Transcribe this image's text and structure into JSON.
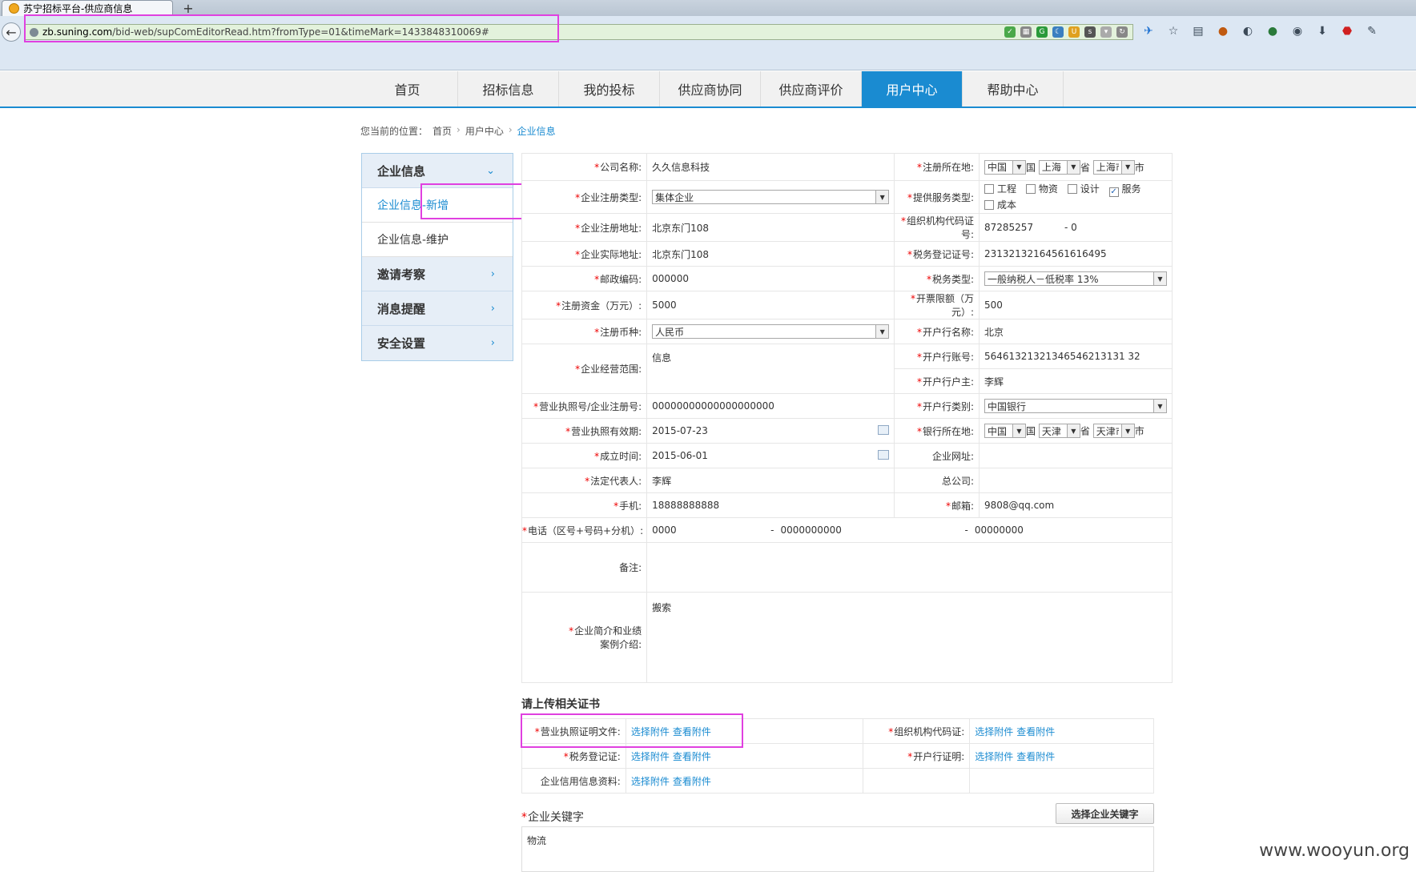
{
  "browser": {
    "tab_title": "苏宁招标平台-供应商信息",
    "new_tab": "+",
    "url_domain": "zb.suning.com",
    "url_path": "/bid-web/supComEditorRead.htm?fromType=01&timeMark=1433848310069#"
  },
  "nav": [
    "首页",
    "招标信息",
    "我的投标",
    "供应商协同",
    "供应商评价",
    "用户中心",
    "帮助中心"
  ],
  "breadcrumb": {
    "prefix": "您当前的位置：",
    "home": "首页",
    "section": "用户中心",
    "current": "企业信息"
  },
  "sidemenu": {
    "group1": "企业信息",
    "items": [
      "企业信息-新增",
      "企业信息-维护"
    ],
    "group2": "邀请考察",
    "group3": "消息提醒",
    "group4": "安全设置"
  },
  "form": {
    "company_name_label": "公司名称:",
    "company_name": "久久信息科技",
    "reg_loc_label": "注册所在地:",
    "reg_country": "中国",
    "reg_country_unit": "国",
    "reg_province": "上海",
    "reg_province_unit": "省",
    "reg_city": "上海市",
    "reg_city_unit": "市",
    "reg_type_label": "企业注册类型:",
    "reg_type": "集体企业",
    "service_label": "提供服务类型:",
    "service_options": [
      "工程",
      "物资",
      "设计",
      "服务",
      "成本"
    ],
    "reg_addr_label": "企业注册地址:",
    "reg_addr": "北京东门108",
    "org_code_label": "组织机构代码证号:",
    "org_code": "87285257",
    "org_code_sep": "- 0",
    "real_addr_label": "企业实际地址:",
    "real_addr": "北京东门108",
    "tax_reg_label": "税务登记证号:",
    "tax_reg": "23132132164561616495",
    "postcode_label": "邮政编码:",
    "postcode": "000000",
    "tax_type_label": "税务类型:",
    "tax_type": "一般纳税人－低税率 13%",
    "capital_label": "注册资金（万元）:",
    "capital": "5000",
    "invoice_label": "开票限额（万元）:",
    "invoice": "500",
    "currency_label": "注册币种:",
    "currency": "人民币",
    "bank_name_label": "开户行名称:",
    "bank_name": "北京",
    "scope_label": "企业经营范围:",
    "scope": "信息",
    "bank_acct_label": "开户行账号:",
    "bank_acct": "56461321321346546213131 32",
    "bank_owner_label": "开户行户主:",
    "bank_owner": "李辉",
    "license_label": "营业执照号/企业注册号:",
    "license": "00000000000000000000",
    "bank_type_label": "开户行类别:",
    "bank_type": "中国银行",
    "license_valid_label": "营业执照有效期:",
    "license_valid": "2015-07-23",
    "bank_loc_label": "银行所在地:",
    "bank_country": "中国",
    "bank_country_unit": "国",
    "bank_province": "天津",
    "bank_province_unit": "省",
    "bank_city": "天津市",
    "bank_city_unit": "市",
    "founded_label": "成立时间:",
    "founded": "2015-06-01",
    "website_label": "企业网址:",
    "legal_label": "法定代表人:",
    "legal": "李辉",
    "hq_label": "总公司:",
    "mobile_label": "手机:",
    "mobile": "18888888888",
    "email_label": "邮箱:",
    "email": "9808@qq.com",
    "phone_label": "电话（区号+号码+分机）:",
    "phone_area": "0000",
    "phone_num": "0000000000",
    "phone_ext": "00000000",
    "phone_sep": "-",
    "remark_label": "备注:",
    "intro_label_1": "企业简介和业绩",
    "intro_label_2": "案例介绍:",
    "intro": "搬索"
  },
  "certs": {
    "title": "请上传相关证书",
    "select": "选择附件",
    "view": "查看附件",
    "license_label": "营业执照证明文件:",
    "org_label": "组织机构代码证:",
    "tax_label": "税务登记证:",
    "bank_label": "开户行证明:",
    "credit_label": "企业信用信息资料:"
  },
  "keywords": {
    "label": "企业关键字",
    "button": "选择企业关键字",
    "value": "物流"
  },
  "watermark": "www.wooyun.org",
  "colors": {
    "accent": "#1a8bd1",
    "highlight": "#e040e0",
    "required": "#e00000"
  }
}
